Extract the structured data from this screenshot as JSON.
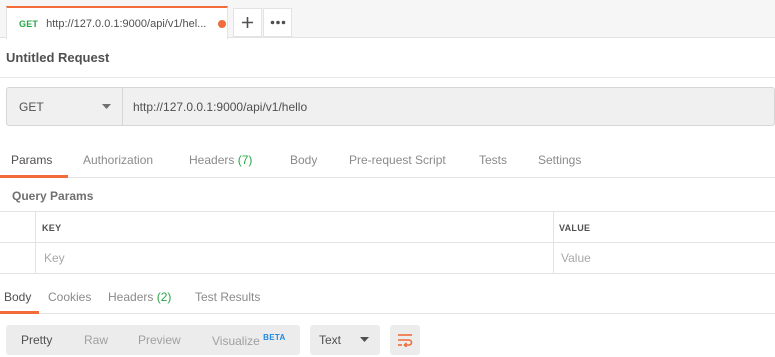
{
  "tabstrip": {
    "tab": {
      "method": "GET",
      "title": "http://127.0.0.1:9000/api/v1/hel..."
    },
    "new_tab_icon": "plus-icon",
    "more_icon": "ellipsis-icon"
  },
  "request": {
    "title": "Untitled Request",
    "method": "GET",
    "url": "http://127.0.0.1:9000/api/v1/hello"
  },
  "request_tabs": [
    {
      "label": "Params",
      "count": ""
    },
    {
      "label": "Authorization",
      "count": ""
    },
    {
      "label": "Headers",
      "count": "(7)"
    },
    {
      "label": "Body",
      "count": ""
    },
    {
      "label": "Pre-request Script",
      "count": ""
    },
    {
      "label": "Tests",
      "count": ""
    },
    {
      "label": "Settings",
      "count": ""
    }
  ],
  "params": {
    "section_label": "Query Params",
    "columns": [
      "KEY",
      "VALUE"
    ],
    "placeholder_key": "Key",
    "placeholder_value": "Value"
  },
  "response_tabs": [
    {
      "label": "Body",
      "count": ""
    },
    {
      "label": "Cookies",
      "count": ""
    },
    {
      "label": "Headers",
      "count": "(2)"
    },
    {
      "label": "Test Results",
      "count": ""
    }
  ],
  "response_toolbar": {
    "views": [
      "Pretty",
      "Raw",
      "Preview",
      "Visualize"
    ],
    "beta_badge": "BETA",
    "format": "Text",
    "wrap_icon": "wrap-lines-icon"
  },
  "colors": {
    "accent": "#f26b3a",
    "method_get": "#28a745",
    "count": "#28a745",
    "beta": "#1e88e5"
  }
}
